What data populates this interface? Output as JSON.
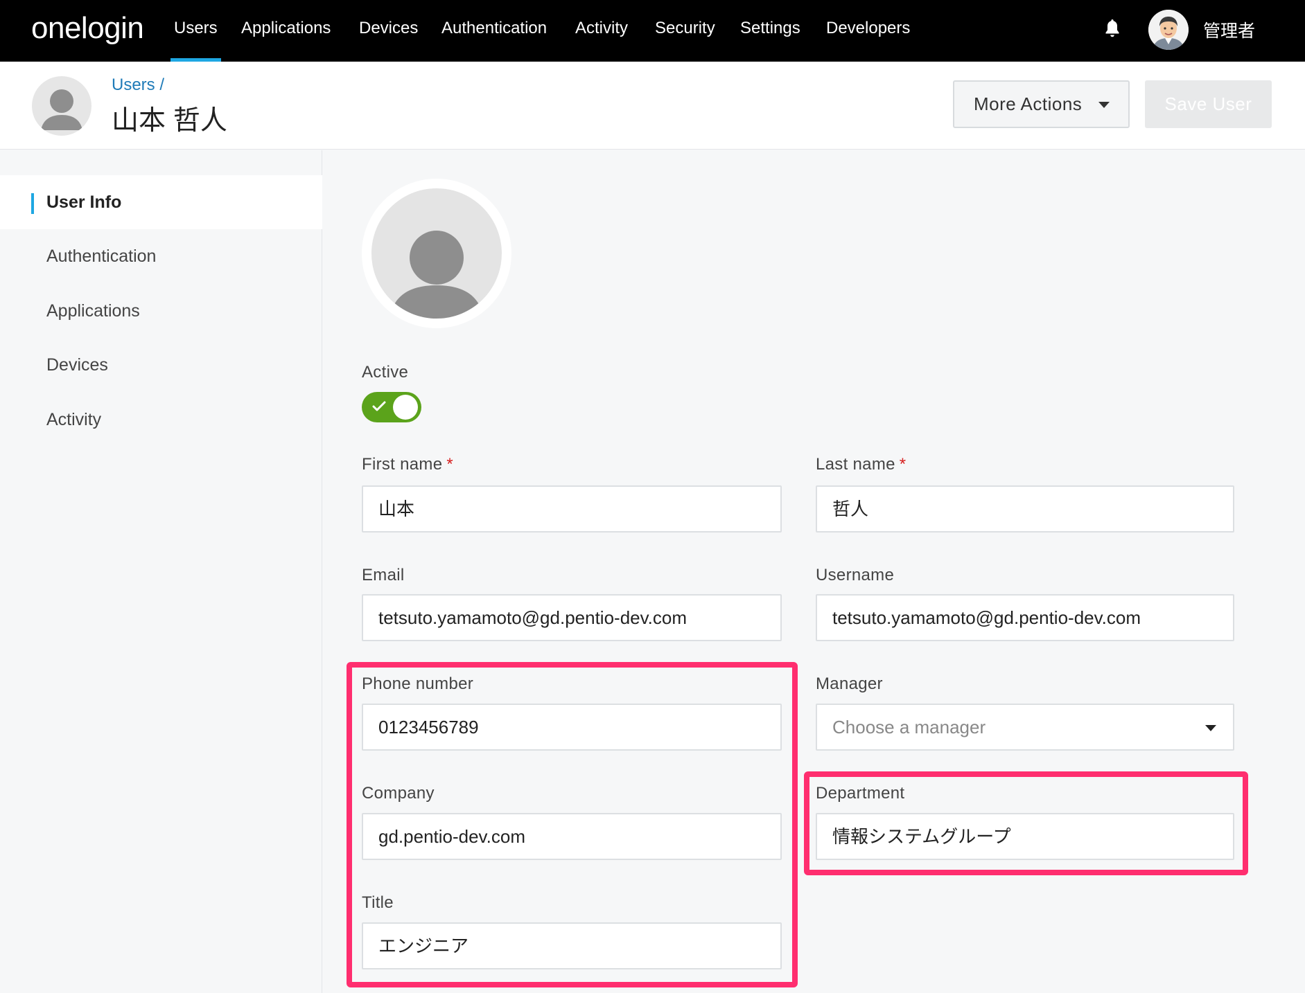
{
  "topnav": {
    "logo": "onelogin",
    "items": [
      "Users",
      "Applications",
      "Devices",
      "Authentication",
      "Activity",
      "Security",
      "Settings",
      "Developers"
    ],
    "active": "Users",
    "admin_name": "管理者"
  },
  "header": {
    "breadcrumb": "Users /",
    "title": "山本 哲人",
    "more_actions_label": "More Actions",
    "save_label": "Save User"
  },
  "sidebar": {
    "items": [
      {
        "label": "User Info",
        "active": true
      },
      {
        "label": "Authentication",
        "active": false
      },
      {
        "label": "Applications",
        "active": false
      },
      {
        "label": "Devices",
        "active": false
      },
      {
        "label": "Activity",
        "active": false
      }
    ]
  },
  "form": {
    "active_label": "Active",
    "active_value": true,
    "required_mark": "*",
    "first_name": {
      "label": "First name",
      "value": "山本"
    },
    "last_name": {
      "label": "Last name",
      "value": "哲人"
    },
    "email": {
      "label": "Email",
      "value": "tetsuto.yamamoto@gd.pentio-dev.com"
    },
    "username": {
      "label": "Username",
      "value": "tetsuto.yamamoto@gd.pentio-dev.com"
    },
    "phone": {
      "label": "Phone number",
      "value": "0123456789"
    },
    "manager": {
      "label": "Manager",
      "placeholder": "Choose a manager"
    },
    "company": {
      "label": "Company",
      "value": "gd.pentio-dev.com"
    },
    "department": {
      "label": "Department",
      "value": "情報システムグループ"
    },
    "title": {
      "label": "Title",
      "value": "エンジニア"
    }
  },
  "colors": {
    "accent": "#1ea7e2",
    "toggle_on": "#5ba31b",
    "highlight": "#ff2e6f",
    "link": "#1f7bb8"
  }
}
